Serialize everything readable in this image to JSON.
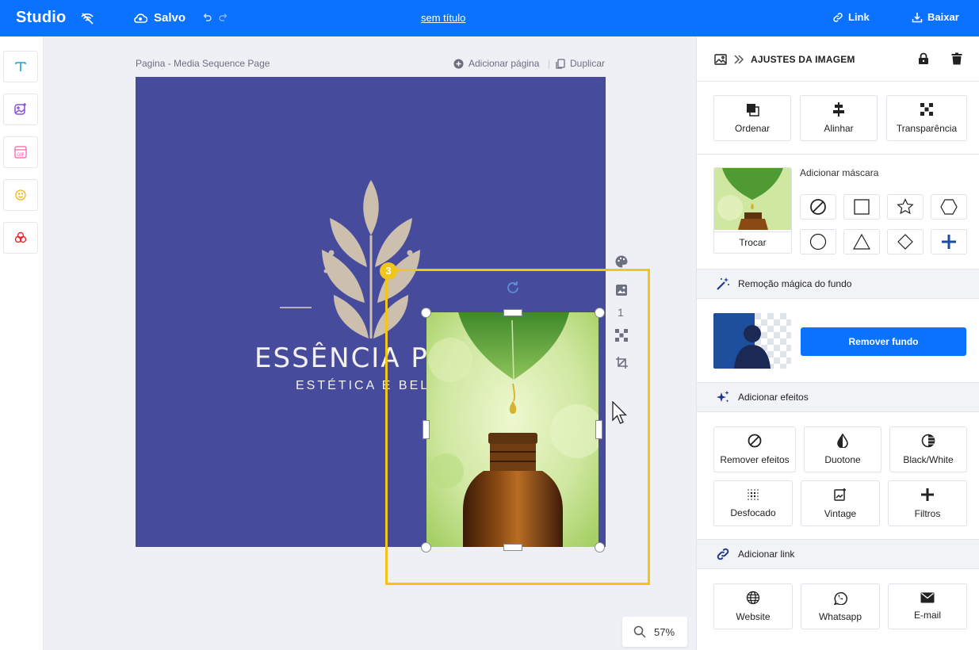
{
  "topbar": {
    "logo": "Studio",
    "saved_label": "Salvo",
    "doc_title": "sem título",
    "link_label": "Link",
    "download_label": "Baixar"
  },
  "leftbar": {
    "tools": [
      "text-tool",
      "image-tool",
      "gif-tool",
      "emoji-tool",
      "shapes-tool"
    ]
  },
  "canvas": {
    "page_title": "Pagina - Media Sequence Page",
    "add_page_label": "Adicionar página",
    "duplicate_label": "Duplicar",
    "brand_name": "ESSÊNCIA P",
    "brand_sub": "ESTÉTICA E BELE",
    "badge_number": "3",
    "page_number": "1",
    "zoom_label": "57%"
  },
  "panel": {
    "header_title": "AJUSTES DA IMAGEM",
    "arrange": {
      "order_label": "Ordenar",
      "align_label": "Alinhar",
      "transparency_label": "Transparência"
    },
    "mask": {
      "title": "Adicionar máscara",
      "swap_label": "Trocar"
    },
    "bg_removal": {
      "section_title": "Remoção mágica do fundo",
      "button_label": "Remover fundo"
    },
    "effects": {
      "section_title": "Adicionar efeitos",
      "items": [
        "Remover efeitos",
        "Duotone",
        "Black/White",
        "Desfocado",
        "Vintage",
        "Filtros"
      ]
    },
    "link": {
      "section_title": "Adicionar link",
      "items": [
        "Website",
        "Whatsapp",
        "E-mail"
      ]
    }
  },
  "colors": {
    "accent": "#0a72ff",
    "canvas_bg": "#474b9c",
    "selection": "#f1c619"
  }
}
